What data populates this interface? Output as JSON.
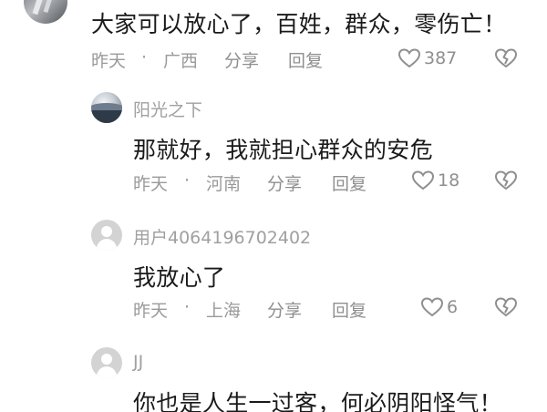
{
  "comments": [
    {
      "text": "大家可以放心了，百姓，群众，零伤亡！",
      "time": "昨天",
      "dot": "·",
      "location": "广西",
      "share_label": "分享",
      "reply_label": "回复",
      "likes": "387"
    },
    {
      "username": "阳光之下",
      "text": "那就好，我就担心群众的安危",
      "time": "昨天",
      "dot": "·",
      "location": "河南",
      "share_label": "分享",
      "reply_label": "回复",
      "likes": "18"
    },
    {
      "username": "用户4064196702402",
      "text": "我放心了",
      "time": "昨天",
      "dot": "·",
      "location": "上海",
      "share_label": "分享",
      "reply_label": "回复",
      "likes": "6"
    },
    {
      "username": "JJ",
      "text": "你也是人生一过客，何必阴阳怪气！"
    }
  ],
  "colors": {
    "text": "#1a1a1a",
    "meta": "#9a9a9a",
    "icon": "#8f8f8f",
    "avatar_default": "#d3d3d3"
  },
  "icons": {
    "like": "heart-outline-icon",
    "dislike": "broken-heart-icon",
    "default_avatar": "user-silhouette-icon"
  }
}
